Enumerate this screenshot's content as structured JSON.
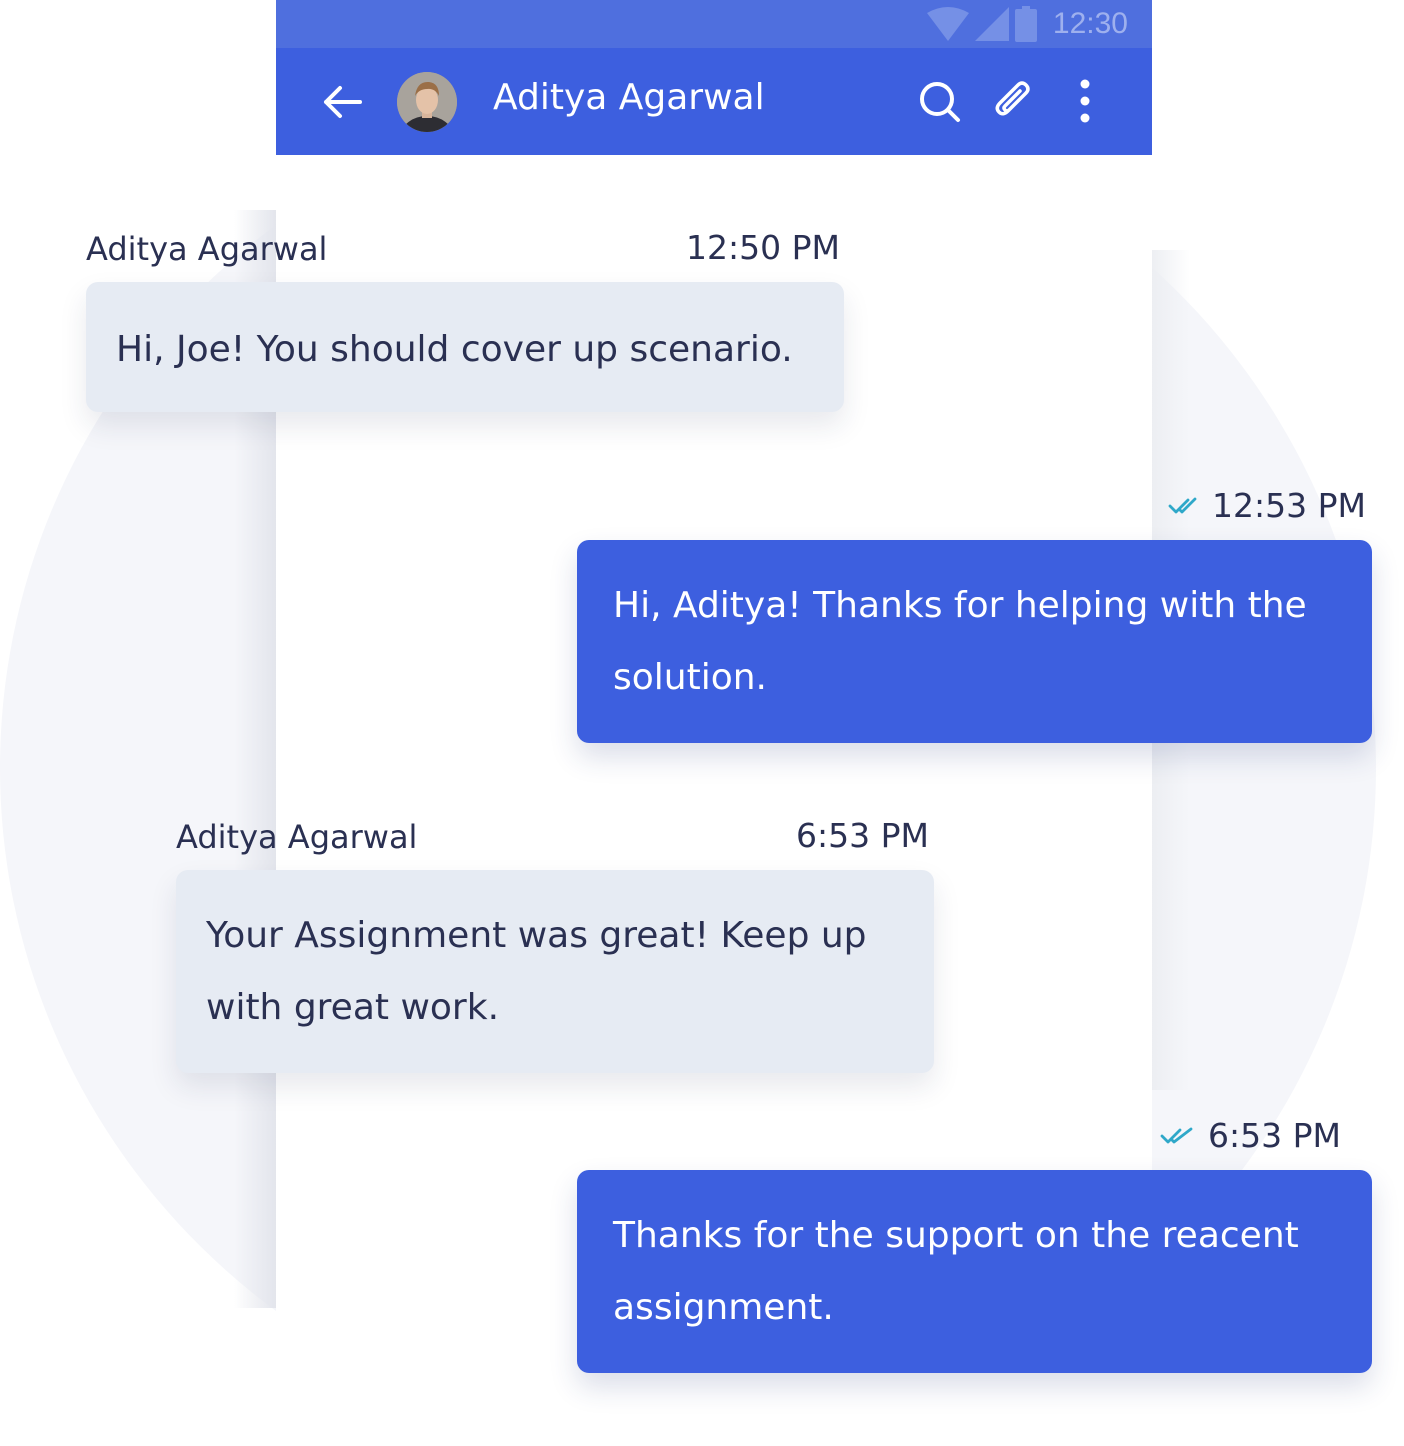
{
  "status_bar": {
    "time": "12:30",
    "icons": [
      "wifi-icon",
      "signal-icon",
      "battery-icon"
    ]
  },
  "header": {
    "contact_name": "Aditya Agarwal",
    "avatar": "contact-avatar",
    "icons": [
      "back-arrow-icon",
      "search-icon",
      "paperclip-icon",
      "more-vert-icon"
    ]
  },
  "messages": [
    {
      "direction": "incoming",
      "sender": "Aditya Agarwal",
      "time": "12:50 PM",
      "text": "Hi, Joe! You should cover up scenario."
    },
    {
      "direction": "outgoing",
      "time": "12:53 PM",
      "status_icon": "double-check-icon",
      "text": "Hi, Aditya! Thanks for helping with the solution."
    },
    {
      "direction": "incoming",
      "sender": "Aditya Agarwal",
      "time": "6:53 PM",
      "text": "Your Assignment was great! Keep up with great work."
    },
    {
      "direction": "outgoing",
      "time": "6:53 PM",
      "status_icon": "double-check-icon",
      "text": "Thanks for the support on the reacent assignment."
    }
  ],
  "colors": {
    "primary": "#3d5fdf",
    "status_bar": "#4f6fde",
    "incoming_bubble": "#e6ebf3",
    "text_dark": "#2a3052",
    "read_check": "#2fa8c9",
    "background_circle": "#f5f6fa"
  }
}
